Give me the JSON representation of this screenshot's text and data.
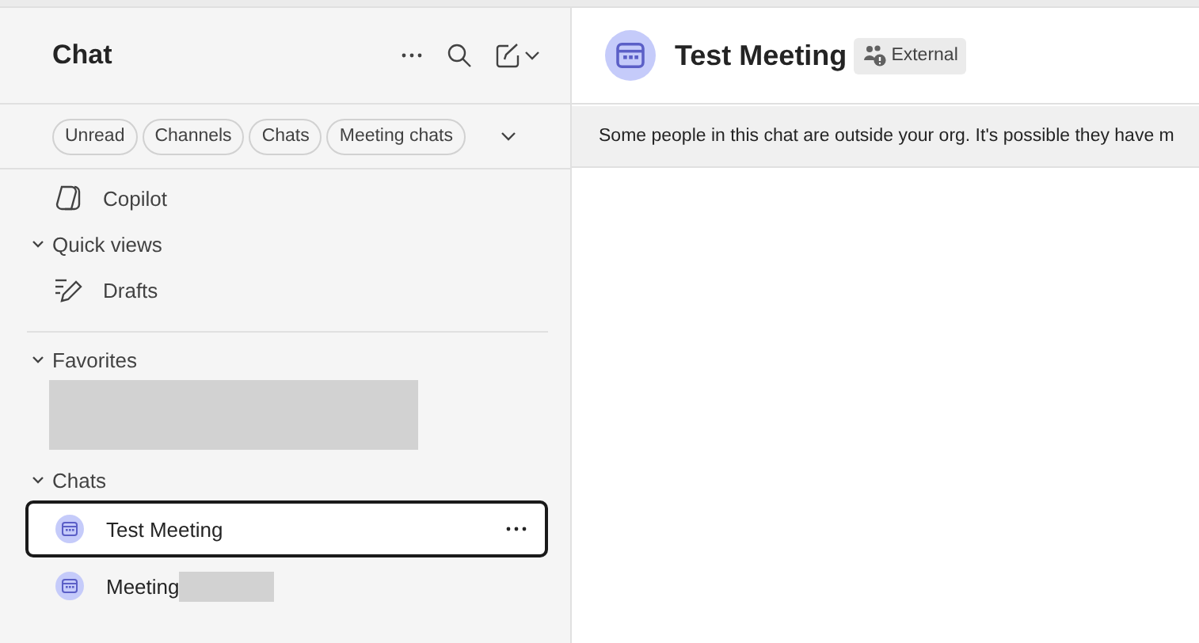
{
  "sidebar": {
    "title": "Chat",
    "filters": [
      {
        "label": "Unread",
        "selected": false
      },
      {
        "label": "Channels",
        "selected": false
      },
      {
        "label": "Chats",
        "selected": false
      },
      {
        "label": "Meeting chats",
        "selected": false
      }
    ],
    "top_items": [
      {
        "label": "Copilot",
        "kind": "copilot"
      }
    ],
    "sections": [
      {
        "label": "Quick views",
        "expanded": true,
        "items": [
          {
            "label": "Drafts",
            "kind": "drafts"
          }
        ]
      },
      {
        "label": "Favorites",
        "expanded": true,
        "items": [
          {
            "kind": "redacted"
          }
        ]
      },
      {
        "label": "Chats",
        "expanded": true,
        "items": [
          {
            "label": "Test Meeting",
            "kind": "meeting",
            "selected": true
          },
          {
            "label": "Meeting",
            "kind": "meeting",
            "selected": false,
            "redacted_suffix": true
          }
        ]
      }
    ]
  },
  "conversation": {
    "title": "Test Meeting",
    "badge": "External",
    "banner": "Some people in this chat are outside your org. It's possible they have m"
  }
}
